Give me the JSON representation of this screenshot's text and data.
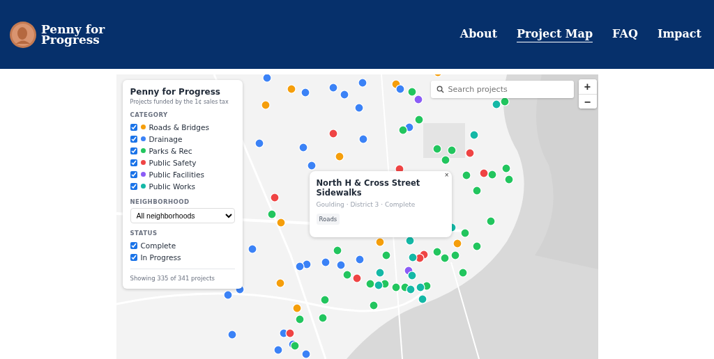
{
  "header": {
    "logo": "Penny for Progress",
    "nav": [
      {
        "label": "About",
        "selected": false
      },
      {
        "label": "Project Map",
        "selected": true
      },
      {
        "label": "FAQ",
        "selected": false
      },
      {
        "label": "Impact",
        "selected": false
      }
    ]
  },
  "panel": {
    "title": "Penny for Progress",
    "subtitle": "Projects funded by the 1¢ sales tax",
    "category_heading": "CATEGORY",
    "categories": [
      {
        "label": "Roads & Bridges",
        "color": "#f59e0b",
        "checked": true
      },
      {
        "label": "Drainage",
        "color": "#3b82f6",
        "checked": true
      },
      {
        "label": "Parks & Rec",
        "color": "#22c55e",
        "checked": true
      },
      {
        "label": "Public Safety",
        "color": "#ef4444",
        "checked": true
      },
      {
        "label": "Public Facilities",
        "color": "#8b5cf6",
        "checked": true
      },
      {
        "label": "Public Works",
        "color": "#14b8a6",
        "checked": true
      }
    ],
    "neighborhood_heading": "NEIGHBORHOOD",
    "neighborhood_select": {
      "value": "All neighborhoods"
    },
    "status_heading": "STATUS",
    "statuses": [
      {
        "label": "Complete",
        "checked": true
      },
      {
        "label": "In Progress",
        "checked": true
      }
    ],
    "footer": "Showing 335 of 341 projects"
  },
  "search": {
    "placeholder": "Search projects"
  },
  "zoom": {
    "in": "+",
    "out": "−"
  },
  "popup": {
    "close": "×",
    "title": "North H & Cross Street Sidewalks",
    "meta": "Goulding · District 3 · Complete",
    "tag": "Roads"
  }
}
